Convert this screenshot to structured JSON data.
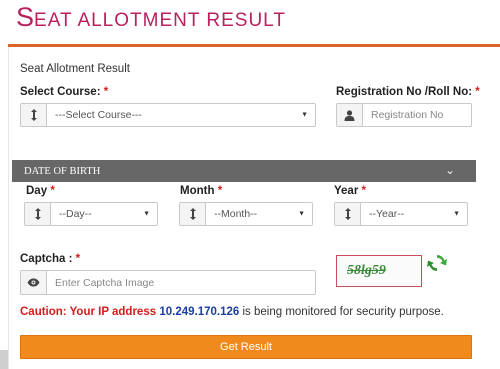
{
  "header": {
    "title_initial": "S",
    "title_rest": "EAT ALLOTMENT RESULT"
  },
  "form": {
    "subtitle": "Seat Allotment Result",
    "required_mark": "*",
    "course": {
      "label": "Select Course:",
      "selected": "---Select Course---",
      "icon": "sort-arrows-icon"
    },
    "registration": {
      "label": "Registration No /Roll No:",
      "placeholder": "Registration No",
      "icon": "user-icon"
    },
    "dob": {
      "section_title": "DATE OF BIRTH",
      "day": {
        "label": "Day",
        "selected": "--Day--"
      },
      "month": {
        "label": "Month",
        "selected": "--Month--"
      },
      "year": {
        "label": "Year",
        "selected": "--Year--"
      }
    },
    "captcha": {
      "label": "Captcha :",
      "placeholder": "Enter Captcha Image",
      "image_text": "58lg59",
      "icon": "eye-icon",
      "refresh_icon": "refresh-icon"
    },
    "caution": {
      "prefix": "Caution: Your IP address",
      "ip": "10.249.170.126",
      "suffix": "is being monitored for security purpose."
    },
    "submit_label": "Get Result"
  },
  "colors": {
    "title": "#b8215e",
    "accent_line": "#d9652b",
    "button": "#f08a1c",
    "dob_bar": "#676767",
    "caution_red": "#d41c1c",
    "ip_blue": "#1b3fa0"
  }
}
